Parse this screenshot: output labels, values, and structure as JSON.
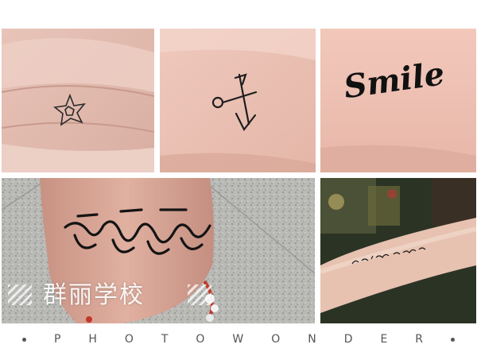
{
  "photos": [
    {
      "subject": "star tattoo on finger"
    },
    {
      "subject": "anchor tattoo on wrist"
    },
    {
      "subject": "Smile script tattoo on wrist",
      "tattoo_text": "Smile"
    },
    {
      "subject": "script tattoo on ankle"
    },
    {
      "subject": "text tattoo on forearm"
    }
  ],
  "watermark": {
    "text": "群丽学校"
  },
  "footer": {
    "letters": [
      "P",
      "H",
      "O",
      "T",
      "O",
      "W",
      "O",
      "N",
      "D",
      "E",
      "R"
    ]
  }
}
